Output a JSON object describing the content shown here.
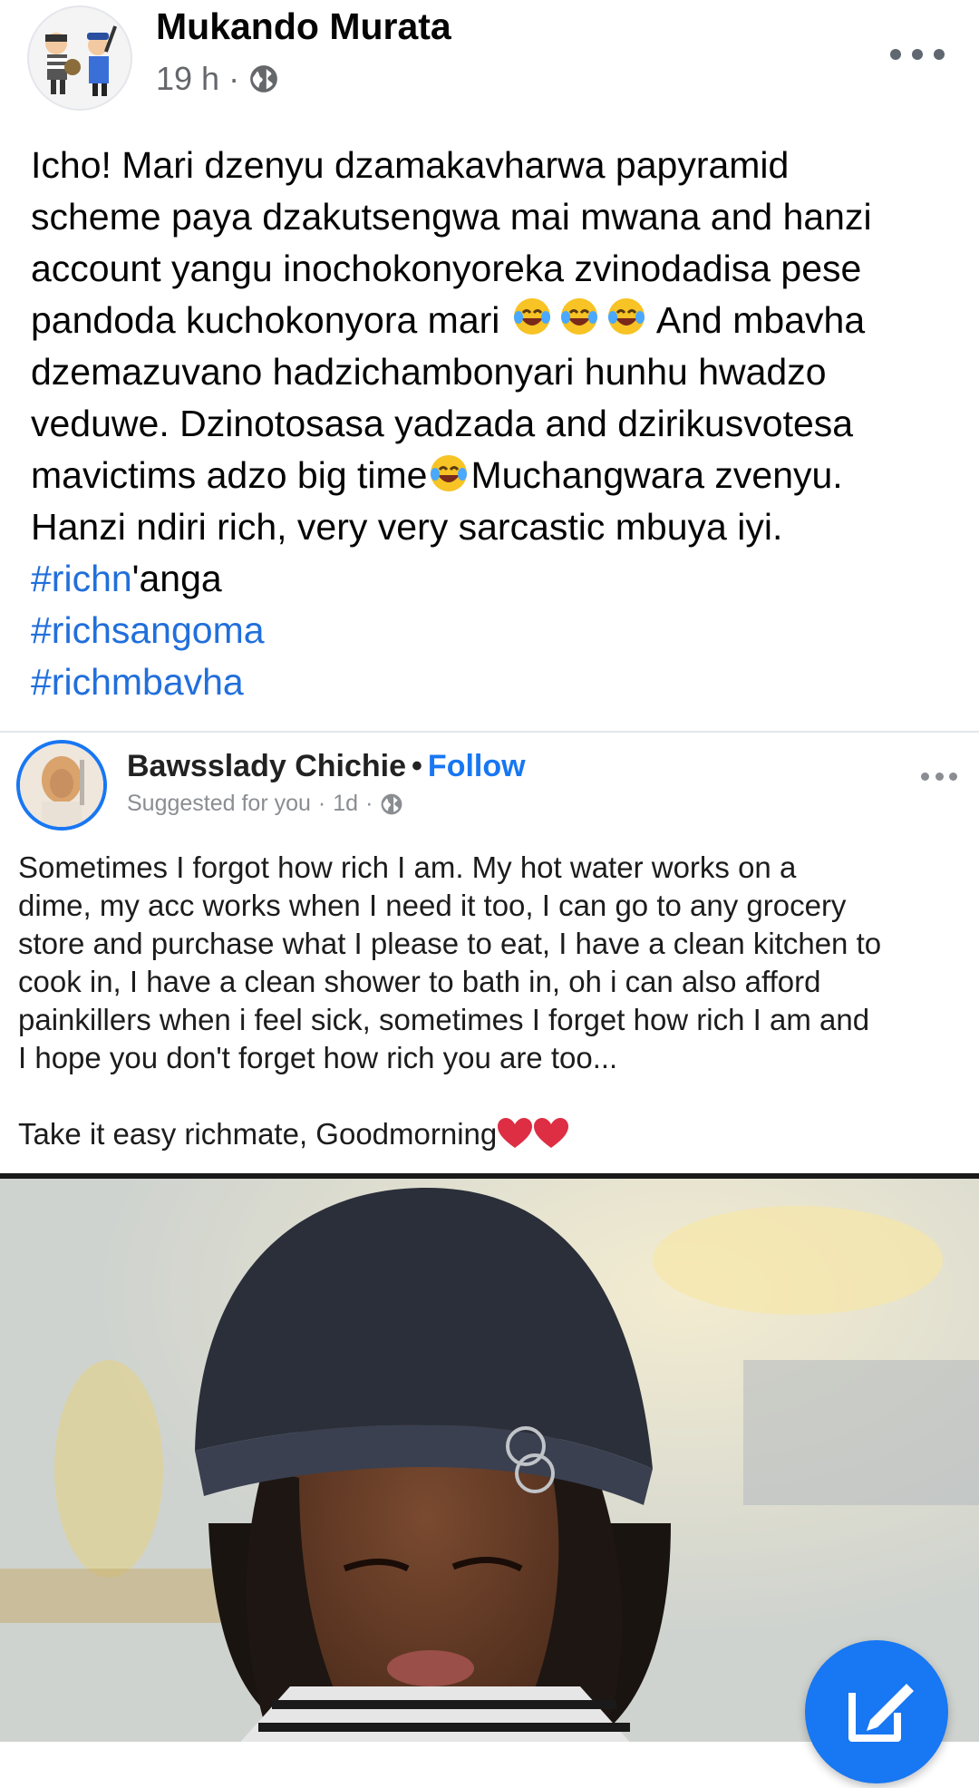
{
  "post": {
    "author": "Mukando Murata",
    "time": "19 h",
    "separator": "·",
    "text_lines": [
      "Icho! Mari dzenyu dzamakavharwa papyramid",
      "scheme paya dzakutsengwa mai mwana and hanzi",
      "account yangu inochokonyoreka zvinodadisa pese"
    ],
    "line4_before": "pandoda kuchokonyora mari ",
    "line4_after": " And mbavha",
    "line5": "dzemazuvano hadzichambonyari hunhu hwadzo",
    "line6": "veduwe. Dzinotosasa yadzada and dzirikusvotesa",
    "line7_before": "mavictims adzo big time",
    "line7_after": "Muchangwara zvenyu.",
    "line8": "Hanzi ndiri rich, very very sarcastic mbuya iyi.",
    "hashtag1": "#richn",
    "hashtag1_suffix": "'anga",
    "hashtag2": "#richsangoma",
    "hashtag3": "#richmbavha"
  },
  "shared": {
    "author": "Bawsslady Chichie",
    "dot": "•",
    "follow": "Follow",
    "suggested": "Suggested for you",
    "sep": "·",
    "time": "1d",
    "lines": [
      "Sometimes I forgot how rich I am. My hot water works on a",
      "dime, my acc works when I need it too, I can go to any grocery",
      "store and purchase what I please to eat, I have a clean kitchen to",
      "cook in, I have a clean shower to bath in, oh i can also afford",
      "painkillers when i feel sick, sometimes I forget how rich I am and",
      "I hope you don't forget how rich you are too..."
    ],
    "closing": "Take it easy richmate, Goodmorning"
  },
  "colors": {
    "hashtag": "#216fdb",
    "follow": "#1877f2",
    "fab": "#1877f2"
  },
  "icons": [
    "robber-police-avatar-icon",
    "globe-icon",
    "more-options-icon",
    "laughing-crying-emoji-icon",
    "red-heart-icon",
    "compose-icon"
  ]
}
